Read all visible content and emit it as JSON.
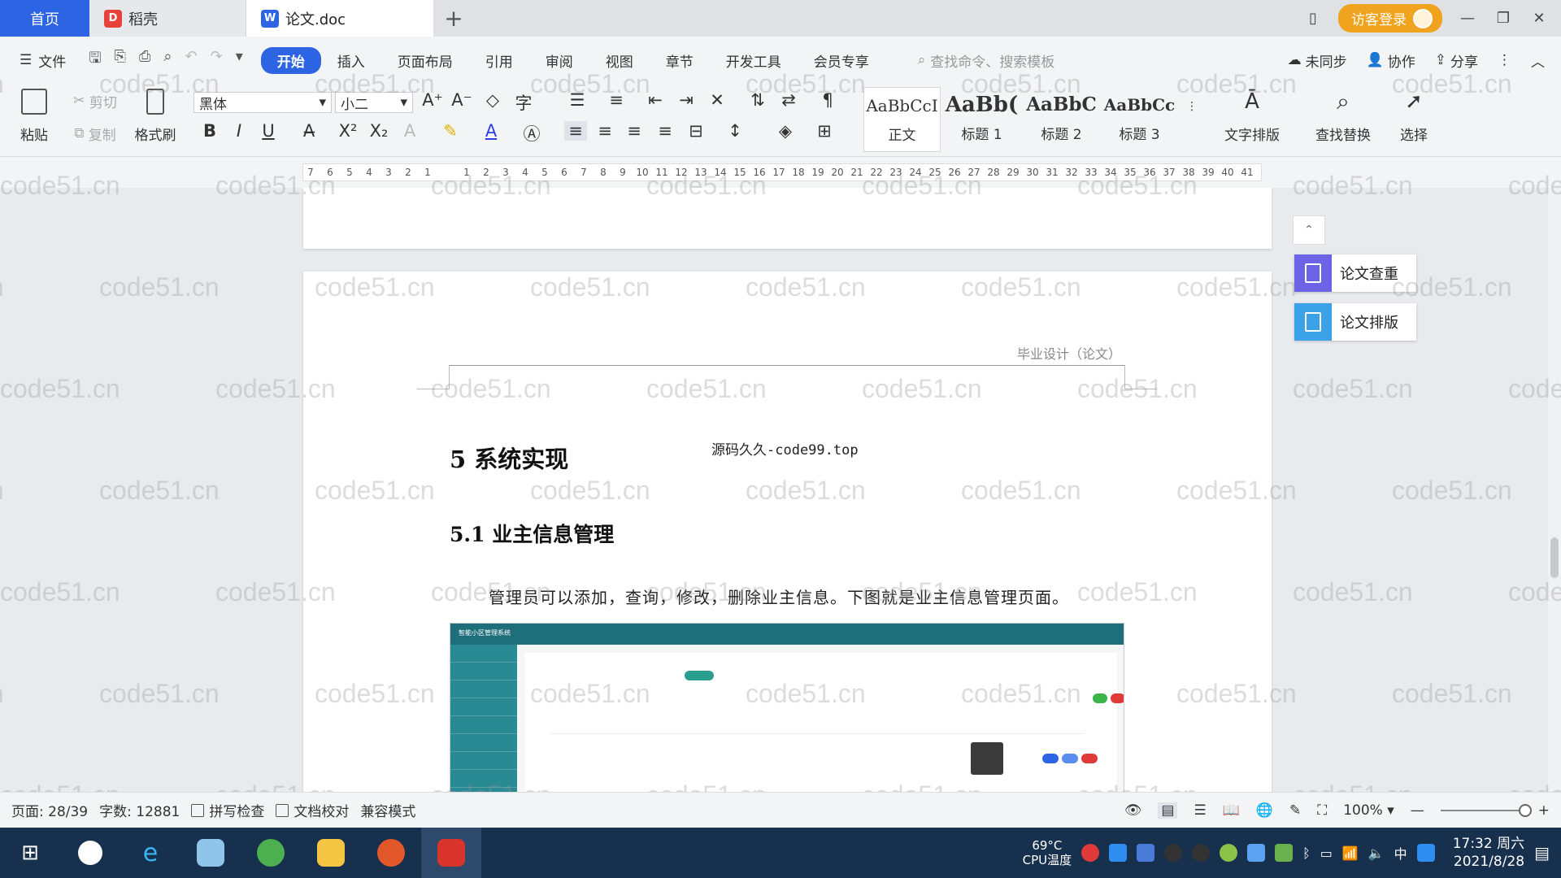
{
  "tabs": {
    "home": "首页",
    "daoke": "稻壳",
    "active_doc": "论文.doc",
    "add": "+",
    "visitor_login": "访客登录"
  },
  "menu": {
    "file": "文件",
    "items": [
      "开始",
      "插入",
      "页面布局",
      "引用",
      "审阅",
      "视图",
      "章节",
      "开发工具",
      "会员专享"
    ],
    "search_placeholder": "查找命令、搜索模板",
    "unsynced": "未同步",
    "collab": "协作",
    "share": "分享"
  },
  "ribbon": {
    "paste": "粘贴",
    "cut": "剪切",
    "copy": "复制",
    "format_painter": "格式刷",
    "font_name": "黑体",
    "font_size": "小二",
    "styles": [
      {
        "preview": "AaBbCcI",
        "label": "正文"
      },
      {
        "preview": "AaBb(",
        "label": "标题 1"
      },
      {
        "preview": "AaBbC",
        "label": "标题 2"
      },
      {
        "preview": "AaBbCc",
        "label": "标题 3"
      }
    ],
    "text_layout": "文字排版",
    "find_replace": "查找替换",
    "select": "选择"
  },
  "ruler": {
    "ticks": [
      "7",
      "6",
      "5",
      "4",
      "3",
      "2",
      "1",
      "",
      "1",
      "2",
      "3",
      "4",
      "5",
      "6",
      "7",
      "8",
      "9",
      "10",
      "11",
      "12",
      "13",
      "14",
      "15",
      "16",
      "17",
      "18",
      "19",
      "20",
      "21",
      "22",
      "23",
      "24",
      "25",
      "26",
      "27",
      "28",
      "29",
      "30",
      "31",
      "32",
      "33",
      "34",
      "35",
      "36",
      "37",
      "38",
      "39",
      "40",
      "41"
    ]
  },
  "document": {
    "header": "毕业设计（论文）",
    "heading1": "5  系统实现",
    "source_text": "源码久久-code99.top",
    "heading2": "5.1  业主信息管理",
    "paragraph": "管理员可以添加，查询，修改，删除业主信息。下图就是业主信息管理页面。",
    "embed_title": "智能小区管理系统"
  },
  "side_panel": {
    "check": "论文查重",
    "layout": "论文排版"
  },
  "watermark": "code51.cn",
  "statusbar": {
    "page": "页面: 28/39",
    "words": "字数: 12881",
    "spell": "拼写检查",
    "proof": "文档校对",
    "compat": "兼容模式",
    "zoom": "100%"
  },
  "taskbar": {
    "cpu_temp": "69°C",
    "cpu_label": "CPU温度",
    "ime": "中",
    "time": "17:32 周六",
    "date": "2021/8/28"
  },
  "colors": {
    "accent": "#2d64e3",
    "visitor": "#f0a31e",
    "taskbar": "#17304e"
  }
}
